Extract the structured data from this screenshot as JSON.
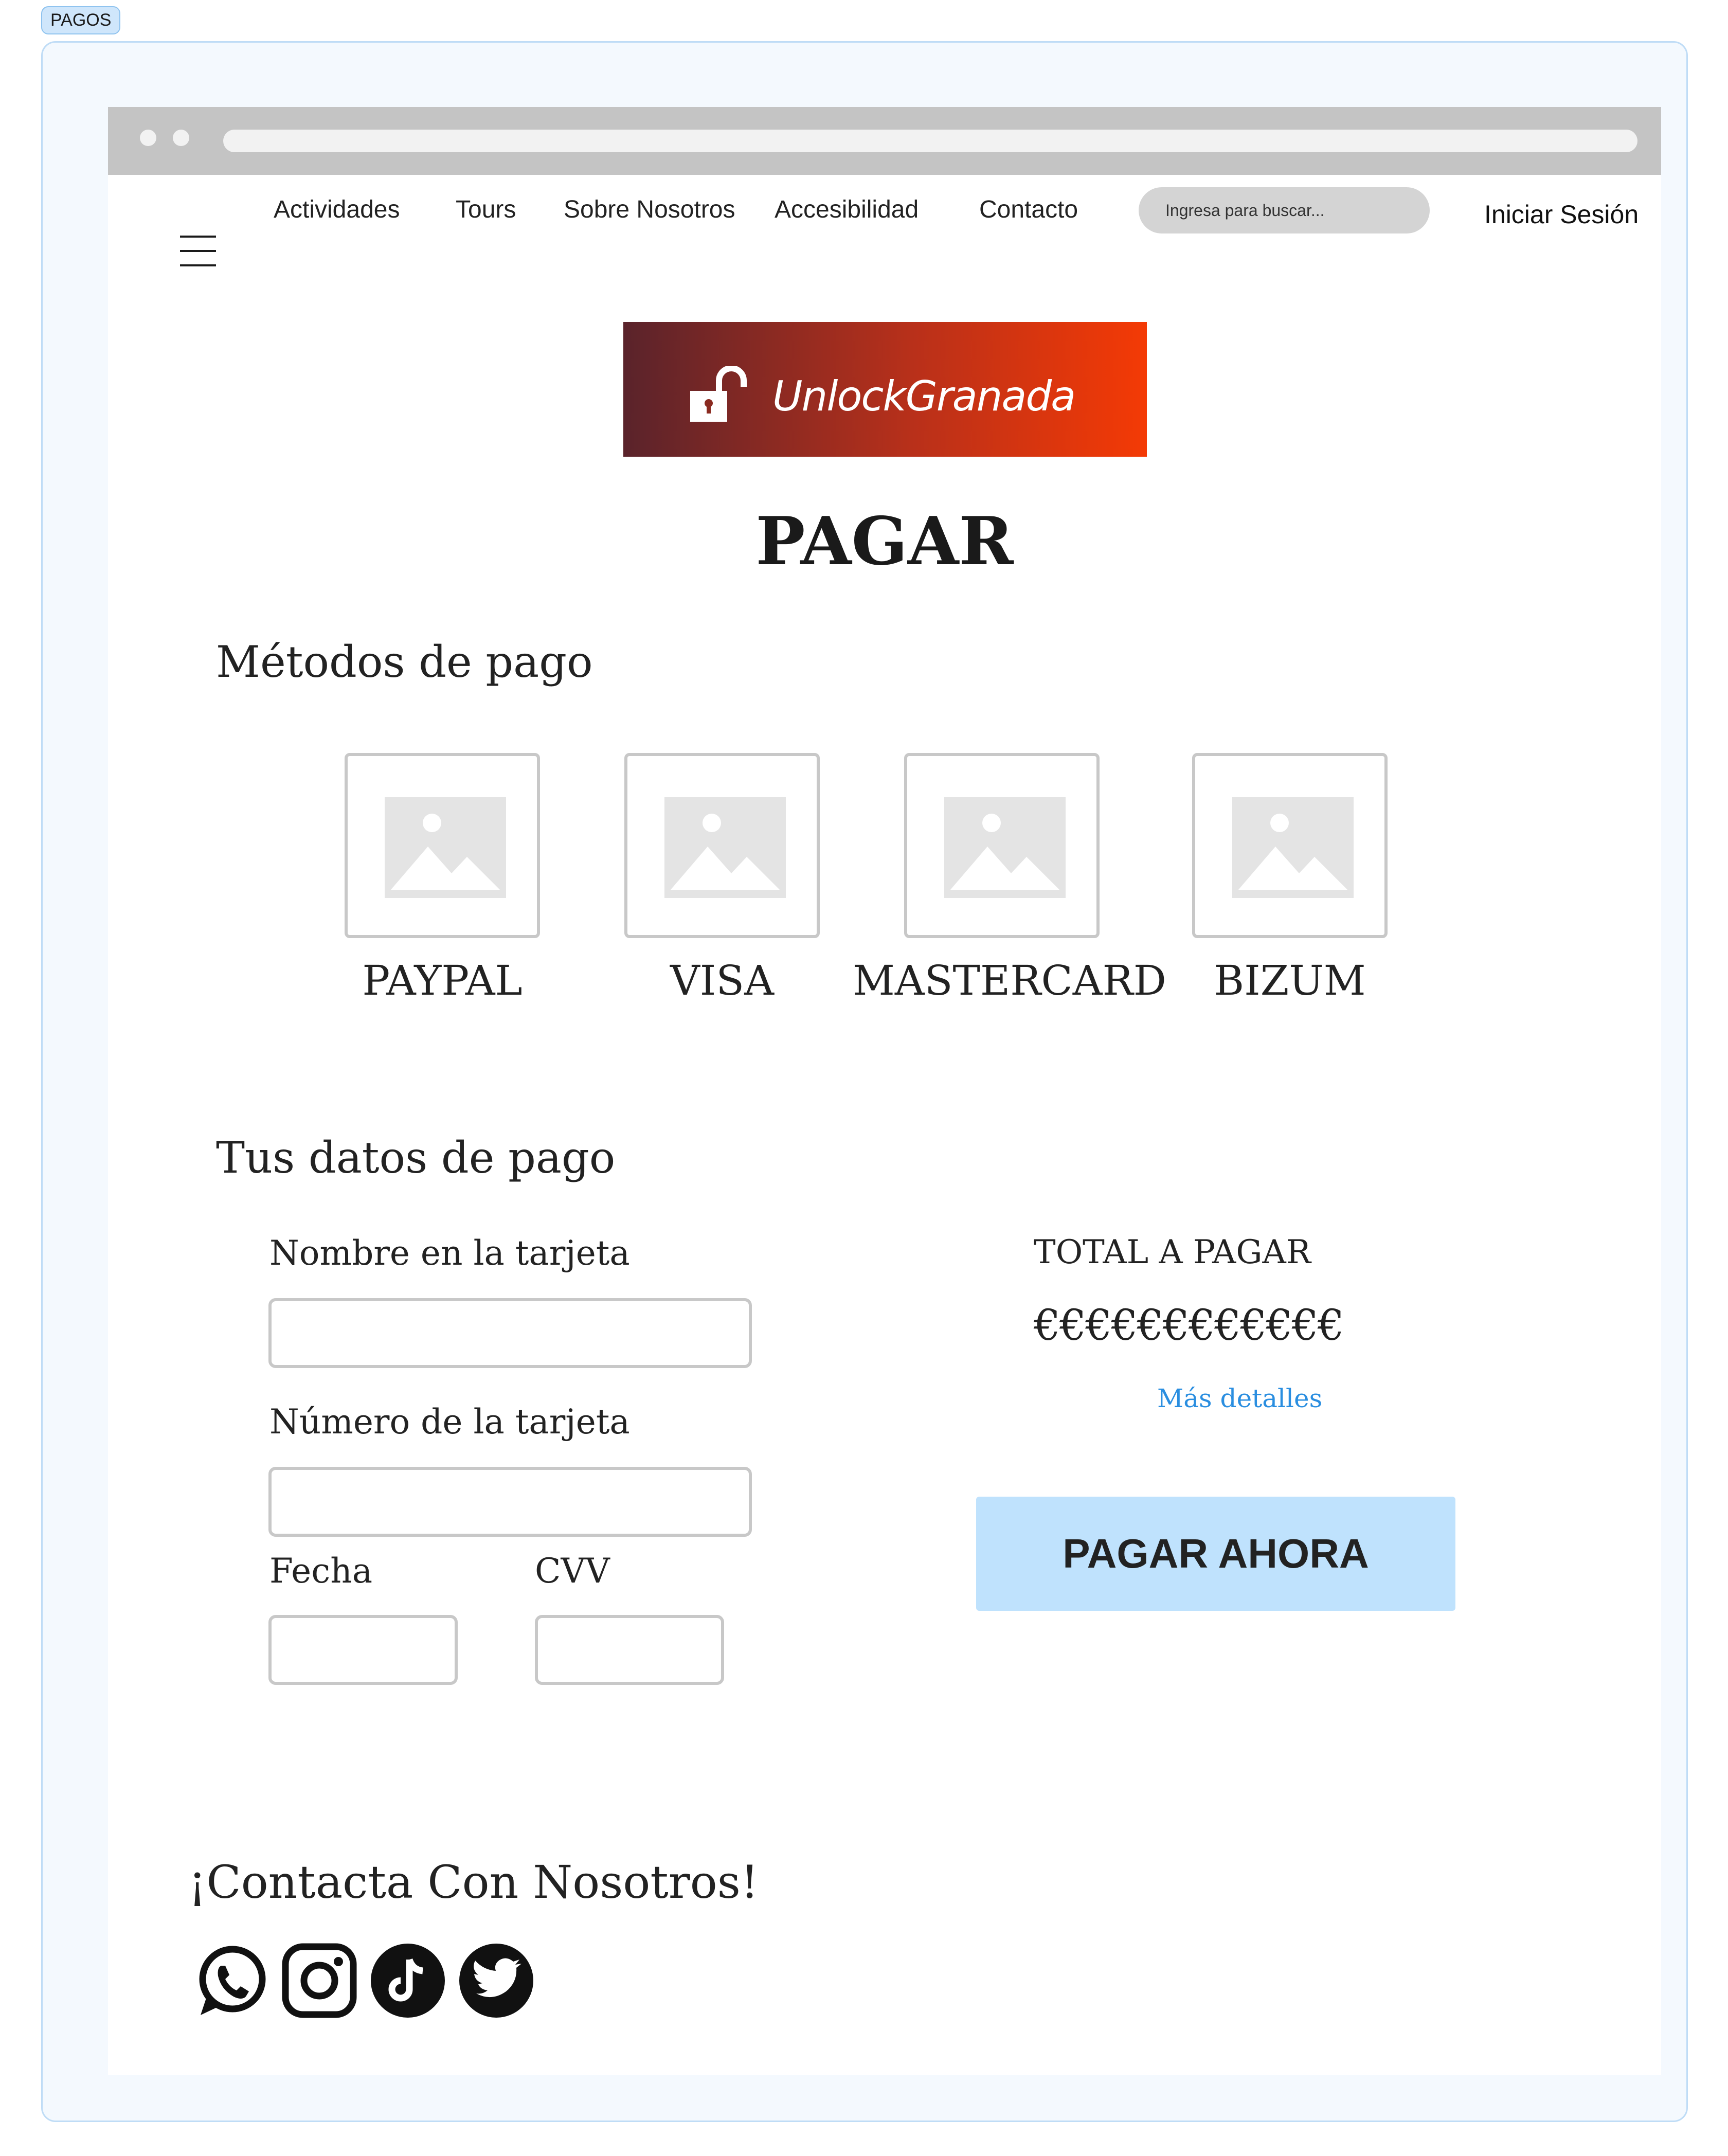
{
  "frame": {
    "tag": "PAGOS"
  },
  "nav": {
    "links": [
      "Actividades",
      "Tours",
      "Sobre Nosotros",
      "Accesibilidad",
      "Contacto"
    ],
    "search_placeholder": "Ingresa para buscar...",
    "login_label": "Iniciar Sesión"
  },
  "logo": {
    "text": "UnlockGranada",
    "icon": "unlock-icon"
  },
  "page": {
    "title": "PAGAR"
  },
  "methods": {
    "title": "Métodos de pago",
    "items": [
      {
        "label": "PAYPAL",
        "icon": "image-placeholder-icon"
      },
      {
        "label": "VISA",
        "icon": "image-placeholder-icon"
      },
      {
        "label": "MASTERCARD",
        "icon": "image-placeholder-icon"
      },
      {
        "label": "BIZUM",
        "icon": "image-placeholder-icon"
      }
    ]
  },
  "form": {
    "title": "Tus datos de pago",
    "name_label": "Nombre en la tarjeta",
    "number_label": "Número de la tarjeta",
    "date_label": "Fecha",
    "cvv_label": "CVV",
    "name_value": "",
    "number_value": "",
    "date_value": "",
    "cvv_value": ""
  },
  "summary": {
    "total_label": "TOTAL A PAGAR",
    "total_value": "€€€€€€€€€€€€",
    "details_link": "Más detalles",
    "pay_button": "PAGAR AHORA"
  },
  "footer": {
    "contact_title": "¡Contacta Con Nosotros!",
    "social_icons": [
      "whatsapp-icon",
      "instagram-icon",
      "tiktok-icon",
      "twitter-icon"
    ]
  },
  "colors": {
    "accent_button": "#bfe2fd",
    "link": "#2a8ee0",
    "logo_gradient_start": "#5a232b",
    "logo_gradient_end": "#f43a05",
    "frame_border": "#bfdcf6"
  }
}
